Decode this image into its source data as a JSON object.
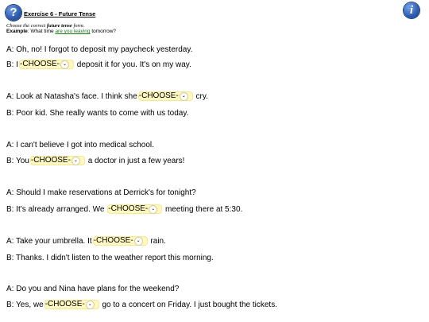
{
  "header": {
    "title": "Exercise 6 - Future Tense",
    "instructions_prefix": "Choose the correct ",
    "instructions_bold": "future tense",
    "instructions_suffix": " form.",
    "example_label": "Example",
    "example_before": ": What time ",
    "example_highlight": "are you leaving",
    "example_after": " tomorrow?"
  },
  "select_placeholder": "-CHOOSE-",
  "icons": {
    "help": "question-mark",
    "info": "info-i"
  },
  "colors": {
    "accent_blue": "#2c5aa8",
    "select_bg": "#fff8bf",
    "example_green": "#1a7a1a"
  },
  "dialogues": [
    {
      "a": "A: Oh, no! I forgot to deposit my paycheck yesterday.",
      "b_before": "B: I",
      "b_after": " deposit it for you. It's on my way."
    },
    {
      "a_before": "A: Look at Natasha's face. I think she",
      "a_after": " cry.",
      "b": "B: Poor kid. She really wants to come with us today."
    },
    {
      "a": "A: I can't believe I got into medical school.",
      "b_before": "B: You",
      "b_after": " a doctor in just a few years!"
    },
    {
      "a": "A: Should I make reservations at Derrick's for tonight?",
      "b_before": "B: It's already arranged. We ",
      "b_after": " meeting there at 5:30."
    },
    {
      "a_before": "A: Take your umbrella. It",
      "a_after": " rain.",
      "b": "B: Thanks. I didn't listen to the weather report this morning."
    },
    {
      "a": "A: Do you and Nina have plans for the weekend?",
      "b_before": "B: Yes, we",
      "b_after": " go to a concert on Friday. I just bought the tickets."
    }
  ]
}
